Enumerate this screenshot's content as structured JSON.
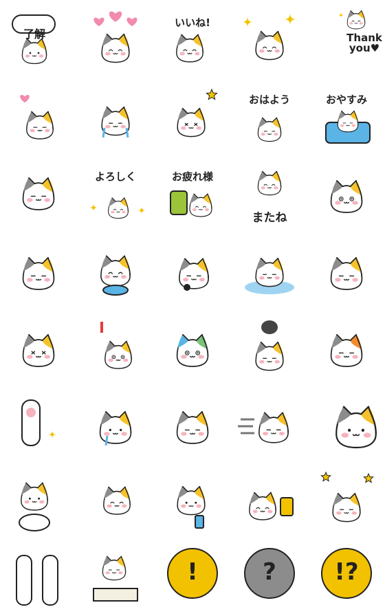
{
  "sheet": {
    "background": "#ffffff",
    "palette": {
      "outline": "#222222",
      "cat_white": "#ffffff",
      "patch_orange": "#f5c22b",
      "patch_gray": "#8c8c8c",
      "cheek_pink": "#f7b3bd",
      "heart_pink": "#f38ab0",
      "star_yellow": "#f2c200",
      "blue": "#5ab4e6"
    }
  },
  "stickers": [
    {
      "id": 1,
      "icon": "speech-bubble-ok",
      "caption": "了解"
    },
    {
      "id": 2,
      "icon": "hearts",
      "caption": ""
    },
    {
      "id": 3,
      "icon": "like-text",
      "caption": "いいね!"
    },
    {
      "id": 4,
      "icon": "sparkles",
      "caption": ""
    },
    {
      "id": 5,
      "icon": "thank-you-text",
      "caption": "Thank you♥"
    },
    {
      "id": 6,
      "icon": "kiss-heart",
      "caption": ""
    },
    {
      "id": 7,
      "icon": "crying",
      "caption": ""
    },
    {
      "id": 8,
      "icon": "wink-star",
      "caption": ""
    },
    {
      "id": 9,
      "icon": "good-morning-text",
      "caption": "おはよう"
    },
    {
      "id": 10,
      "icon": "good-night-text",
      "caption": "おやすみ"
    },
    {
      "id": 11,
      "icon": "peek-cat",
      "caption": ""
    },
    {
      "id": 12,
      "icon": "regards-text",
      "caption": "よろしく"
    },
    {
      "id": 13,
      "icon": "thanks-for-work-text",
      "caption": "お疲れ様"
    },
    {
      "id": 14,
      "icon": "see-you-text",
      "caption": "またね"
    },
    {
      "id": 15,
      "icon": "smug-cat",
      "caption": ""
    },
    {
      "id": 16,
      "icon": "drool-cat",
      "caption": ""
    },
    {
      "id": 17,
      "icon": "fish-cat",
      "caption": ""
    },
    {
      "id": 18,
      "icon": "karaoke-cat",
      "caption": ""
    },
    {
      "id": 19,
      "icon": "bath-cat",
      "caption": ""
    },
    {
      "id": 20,
      "icon": "annoyed-cat",
      "caption": ""
    },
    {
      "id": 21,
      "icon": "sweat-cat",
      "caption": ""
    },
    {
      "id": 22,
      "icon": "surprised-cat",
      "caption": ""
    },
    {
      "id": 23,
      "icon": "shocked-blue-cat",
      "caption": ""
    },
    {
      "id": 24,
      "icon": "storm-cloud-cat",
      "caption": ""
    },
    {
      "id": 25,
      "icon": "angry-cat",
      "caption": ""
    },
    {
      "id": 26,
      "icon": "paw-sparkle",
      "caption": ""
    },
    {
      "id": 27,
      "icon": "tear-cat",
      "caption": ""
    },
    {
      "id": 28,
      "icon": "happy-cat-blank",
      "caption": ""
    },
    {
      "id": 29,
      "icon": "dash-cat",
      "caption": ""
    },
    {
      "id": 30,
      "icon": "big-cat",
      "caption": ""
    },
    {
      "id": 31,
      "icon": "lucky-cat",
      "caption": ""
    },
    {
      "id": 32,
      "icon": "rolling-cat",
      "caption": ""
    },
    {
      "id": 33,
      "icon": "phone-cat",
      "caption": ""
    },
    {
      "id": 34,
      "icon": "beer-cat",
      "caption": ""
    },
    {
      "id": 35,
      "icon": "party-cat",
      "caption": ""
    },
    {
      "id": 36,
      "icon": "paws-up",
      "caption": ""
    },
    {
      "id": 37,
      "icon": "writing-cat",
      "caption": ""
    },
    {
      "id": 38,
      "icon": "exclamation-bubble",
      "caption": "!"
    },
    {
      "id": 39,
      "icon": "question-bubble",
      "caption": "?"
    },
    {
      "id": 40,
      "icon": "exclaim-question-bubble",
      "caption": "!?"
    }
  ]
}
